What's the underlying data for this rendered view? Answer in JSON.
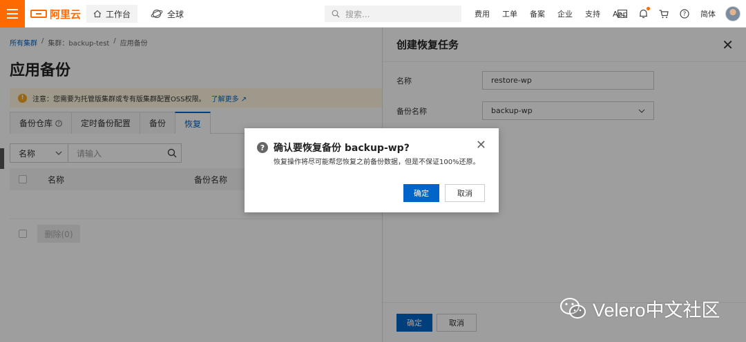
{
  "topbar": {
    "logo_text": "阿里云",
    "workbench_label": "工作台",
    "region_label": "全球",
    "search_placeholder": "搜索...",
    "nav": [
      "费用",
      "工单",
      "备案",
      "企业",
      "支持",
      "App"
    ],
    "language": "简体",
    "colors": {
      "brand": "#ff6a00"
    }
  },
  "page": {
    "breadcrumb": [
      "所有集群",
      "集群：backup-test",
      "应用备份"
    ],
    "title": "应用备份",
    "notice_text": "注意：您需要为托管版集群或专有版集群配置OSS权限。",
    "notice_link": "了解更多",
    "tabs": [
      {
        "label": "备份仓库",
        "has_help": true
      },
      {
        "label": "定时备份配置"
      },
      {
        "label": "备份"
      },
      {
        "label": "恢复",
        "active": true
      }
    ],
    "filter_field": "名称",
    "filter_placeholder": "请输入",
    "columns": [
      "名称",
      "备份名称"
    ],
    "bulk_delete_label": "删除(0)"
  },
  "drawer": {
    "title": "创建恢复任务",
    "fields": [
      {
        "label": "名称",
        "value": "restore-wp"
      },
      {
        "label": "备份名称",
        "value": "backup-wp"
      }
    ],
    "confirm_label": "确定",
    "cancel_label": "取消"
  },
  "dialog": {
    "title": "确认要恢复备份 backup-wp?",
    "message": "恢复操作将尽可能帮您恢复之前备份数据，但是不保证100%还原。",
    "confirm_label": "确定",
    "cancel_label": "取消"
  },
  "watermark": {
    "text": "Velero中文社区"
  },
  "colors": {
    "primary": "#0064c8",
    "warning": "#f5a623"
  }
}
